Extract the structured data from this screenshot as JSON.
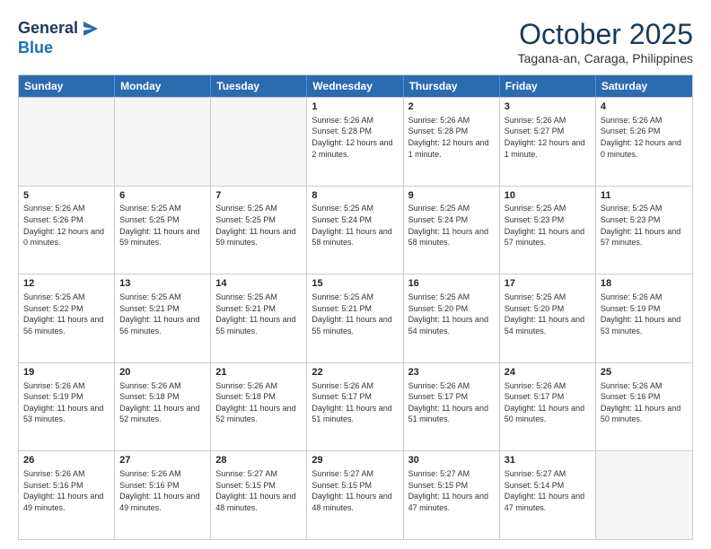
{
  "logo": {
    "line1": "General",
    "line2": "Blue"
  },
  "header": {
    "month": "October 2025",
    "location": "Tagana-an, Caraga, Philippines"
  },
  "days_of_week": [
    "Sunday",
    "Monday",
    "Tuesday",
    "Wednesday",
    "Thursday",
    "Friday",
    "Saturday"
  ],
  "weeks": [
    [
      {
        "day": "",
        "sunrise": "",
        "sunset": "",
        "daylight": "",
        "empty": true
      },
      {
        "day": "",
        "sunrise": "",
        "sunset": "",
        "daylight": "",
        "empty": true
      },
      {
        "day": "",
        "sunrise": "",
        "sunset": "",
        "daylight": "",
        "empty": true
      },
      {
        "day": "1",
        "sunrise": "Sunrise: 5:26 AM",
        "sunset": "Sunset: 5:28 PM",
        "daylight": "Daylight: 12 hours and 2 minutes."
      },
      {
        "day": "2",
        "sunrise": "Sunrise: 5:26 AM",
        "sunset": "Sunset: 5:28 PM",
        "daylight": "Daylight: 12 hours and 1 minute."
      },
      {
        "day": "3",
        "sunrise": "Sunrise: 5:26 AM",
        "sunset": "Sunset: 5:27 PM",
        "daylight": "Daylight: 12 hours and 1 minute."
      },
      {
        "day": "4",
        "sunrise": "Sunrise: 5:26 AM",
        "sunset": "Sunset: 5:26 PM",
        "daylight": "Daylight: 12 hours and 0 minutes."
      }
    ],
    [
      {
        "day": "5",
        "sunrise": "Sunrise: 5:26 AM",
        "sunset": "Sunset: 5:26 PM",
        "daylight": "Daylight: 12 hours and 0 minutes."
      },
      {
        "day": "6",
        "sunrise": "Sunrise: 5:25 AM",
        "sunset": "Sunset: 5:25 PM",
        "daylight": "Daylight: 11 hours and 59 minutes."
      },
      {
        "day": "7",
        "sunrise": "Sunrise: 5:25 AM",
        "sunset": "Sunset: 5:25 PM",
        "daylight": "Daylight: 11 hours and 59 minutes."
      },
      {
        "day": "8",
        "sunrise": "Sunrise: 5:25 AM",
        "sunset": "Sunset: 5:24 PM",
        "daylight": "Daylight: 11 hours and 58 minutes."
      },
      {
        "day": "9",
        "sunrise": "Sunrise: 5:25 AM",
        "sunset": "Sunset: 5:24 PM",
        "daylight": "Daylight: 11 hours and 58 minutes."
      },
      {
        "day": "10",
        "sunrise": "Sunrise: 5:25 AM",
        "sunset": "Sunset: 5:23 PM",
        "daylight": "Daylight: 11 hours and 57 minutes."
      },
      {
        "day": "11",
        "sunrise": "Sunrise: 5:25 AM",
        "sunset": "Sunset: 5:23 PM",
        "daylight": "Daylight: 11 hours and 57 minutes."
      }
    ],
    [
      {
        "day": "12",
        "sunrise": "Sunrise: 5:25 AM",
        "sunset": "Sunset: 5:22 PM",
        "daylight": "Daylight: 11 hours and 56 minutes."
      },
      {
        "day": "13",
        "sunrise": "Sunrise: 5:25 AM",
        "sunset": "Sunset: 5:21 PM",
        "daylight": "Daylight: 11 hours and 56 minutes."
      },
      {
        "day": "14",
        "sunrise": "Sunrise: 5:25 AM",
        "sunset": "Sunset: 5:21 PM",
        "daylight": "Daylight: 11 hours and 55 minutes."
      },
      {
        "day": "15",
        "sunrise": "Sunrise: 5:25 AM",
        "sunset": "Sunset: 5:21 PM",
        "daylight": "Daylight: 11 hours and 55 minutes."
      },
      {
        "day": "16",
        "sunrise": "Sunrise: 5:25 AM",
        "sunset": "Sunset: 5:20 PM",
        "daylight": "Daylight: 11 hours and 54 minutes."
      },
      {
        "day": "17",
        "sunrise": "Sunrise: 5:25 AM",
        "sunset": "Sunset: 5:20 PM",
        "daylight": "Daylight: 11 hours and 54 minutes."
      },
      {
        "day": "18",
        "sunrise": "Sunrise: 5:26 AM",
        "sunset": "Sunset: 5:19 PM",
        "daylight": "Daylight: 11 hours and 53 minutes."
      }
    ],
    [
      {
        "day": "19",
        "sunrise": "Sunrise: 5:26 AM",
        "sunset": "Sunset: 5:19 PM",
        "daylight": "Daylight: 11 hours and 53 minutes."
      },
      {
        "day": "20",
        "sunrise": "Sunrise: 5:26 AM",
        "sunset": "Sunset: 5:18 PM",
        "daylight": "Daylight: 11 hours and 52 minutes."
      },
      {
        "day": "21",
        "sunrise": "Sunrise: 5:26 AM",
        "sunset": "Sunset: 5:18 PM",
        "daylight": "Daylight: 11 hours and 52 minutes."
      },
      {
        "day": "22",
        "sunrise": "Sunrise: 5:26 AM",
        "sunset": "Sunset: 5:17 PM",
        "daylight": "Daylight: 11 hours and 51 minutes."
      },
      {
        "day": "23",
        "sunrise": "Sunrise: 5:26 AM",
        "sunset": "Sunset: 5:17 PM",
        "daylight": "Daylight: 11 hours and 51 minutes."
      },
      {
        "day": "24",
        "sunrise": "Sunrise: 5:26 AM",
        "sunset": "Sunset: 5:17 PM",
        "daylight": "Daylight: 11 hours and 50 minutes."
      },
      {
        "day": "25",
        "sunrise": "Sunrise: 5:26 AM",
        "sunset": "Sunset: 5:16 PM",
        "daylight": "Daylight: 11 hours and 50 minutes."
      }
    ],
    [
      {
        "day": "26",
        "sunrise": "Sunrise: 5:26 AM",
        "sunset": "Sunset: 5:16 PM",
        "daylight": "Daylight: 11 hours and 49 minutes."
      },
      {
        "day": "27",
        "sunrise": "Sunrise: 5:26 AM",
        "sunset": "Sunset: 5:16 PM",
        "daylight": "Daylight: 11 hours and 49 minutes."
      },
      {
        "day": "28",
        "sunrise": "Sunrise: 5:27 AM",
        "sunset": "Sunset: 5:15 PM",
        "daylight": "Daylight: 11 hours and 48 minutes."
      },
      {
        "day": "29",
        "sunrise": "Sunrise: 5:27 AM",
        "sunset": "Sunset: 5:15 PM",
        "daylight": "Daylight: 11 hours and 48 minutes."
      },
      {
        "day": "30",
        "sunrise": "Sunrise: 5:27 AM",
        "sunset": "Sunset: 5:15 PM",
        "daylight": "Daylight: 11 hours and 47 minutes."
      },
      {
        "day": "31",
        "sunrise": "Sunrise: 5:27 AM",
        "sunset": "Sunset: 5:14 PM",
        "daylight": "Daylight: 11 hours and 47 minutes."
      },
      {
        "day": "",
        "sunrise": "",
        "sunset": "",
        "daylight": "",
        "empty": true
      }
    ]
  ]
}
